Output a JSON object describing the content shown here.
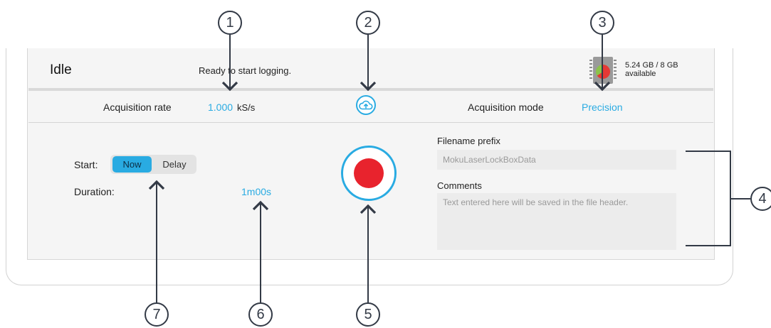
{
  "status": {
    "state": "Idle",
    "message": "Ready to start logging.",
    "storage_line1": "5.24 GB / 8 GB",
    "storage_line2": "available",
    "storage_used_fraction": 0.655
  },
  "settings": {
    "acquisition_rate_label": "Acquisition rate",
    "acquisition_rate_value": "1.000",
    "acquisition_rate_unit": "kS/s",
    "acquisition_mode_label": "Acquisition mode",
    "acquisition_mode_value": "Precision"
  },
  "logging": {
    "start_label": "Start:",
    "start_options": [
      "Now",
      "Delay"
    ],
    "start_selected": "Now",
    "duration_label": "Duration:",
    "duration_value": "1m00s"
  },
  "file": {
    "filename_label": "Filename prefix",
    "filename_placeholder": "MokuLaserLockBoxData",
    "comments_label": "Comments",
    "comments_placeholder": "Text entered here will be saved in the file header."
  },
  "callouts": [
    "1",
    "2",
    "3",
    "4",
    "5",
    "6",
    "7"
  ],
  "icons": {
    "upload": "cloud-upload-icon",
    "storage": "sd-card-pie-icon",
    "record": "record-icon"
  },
  "colors": {
    "accent": "#29abe2",
    "record": "#e8232d",
    "callout": "#333a46"
  }
}
